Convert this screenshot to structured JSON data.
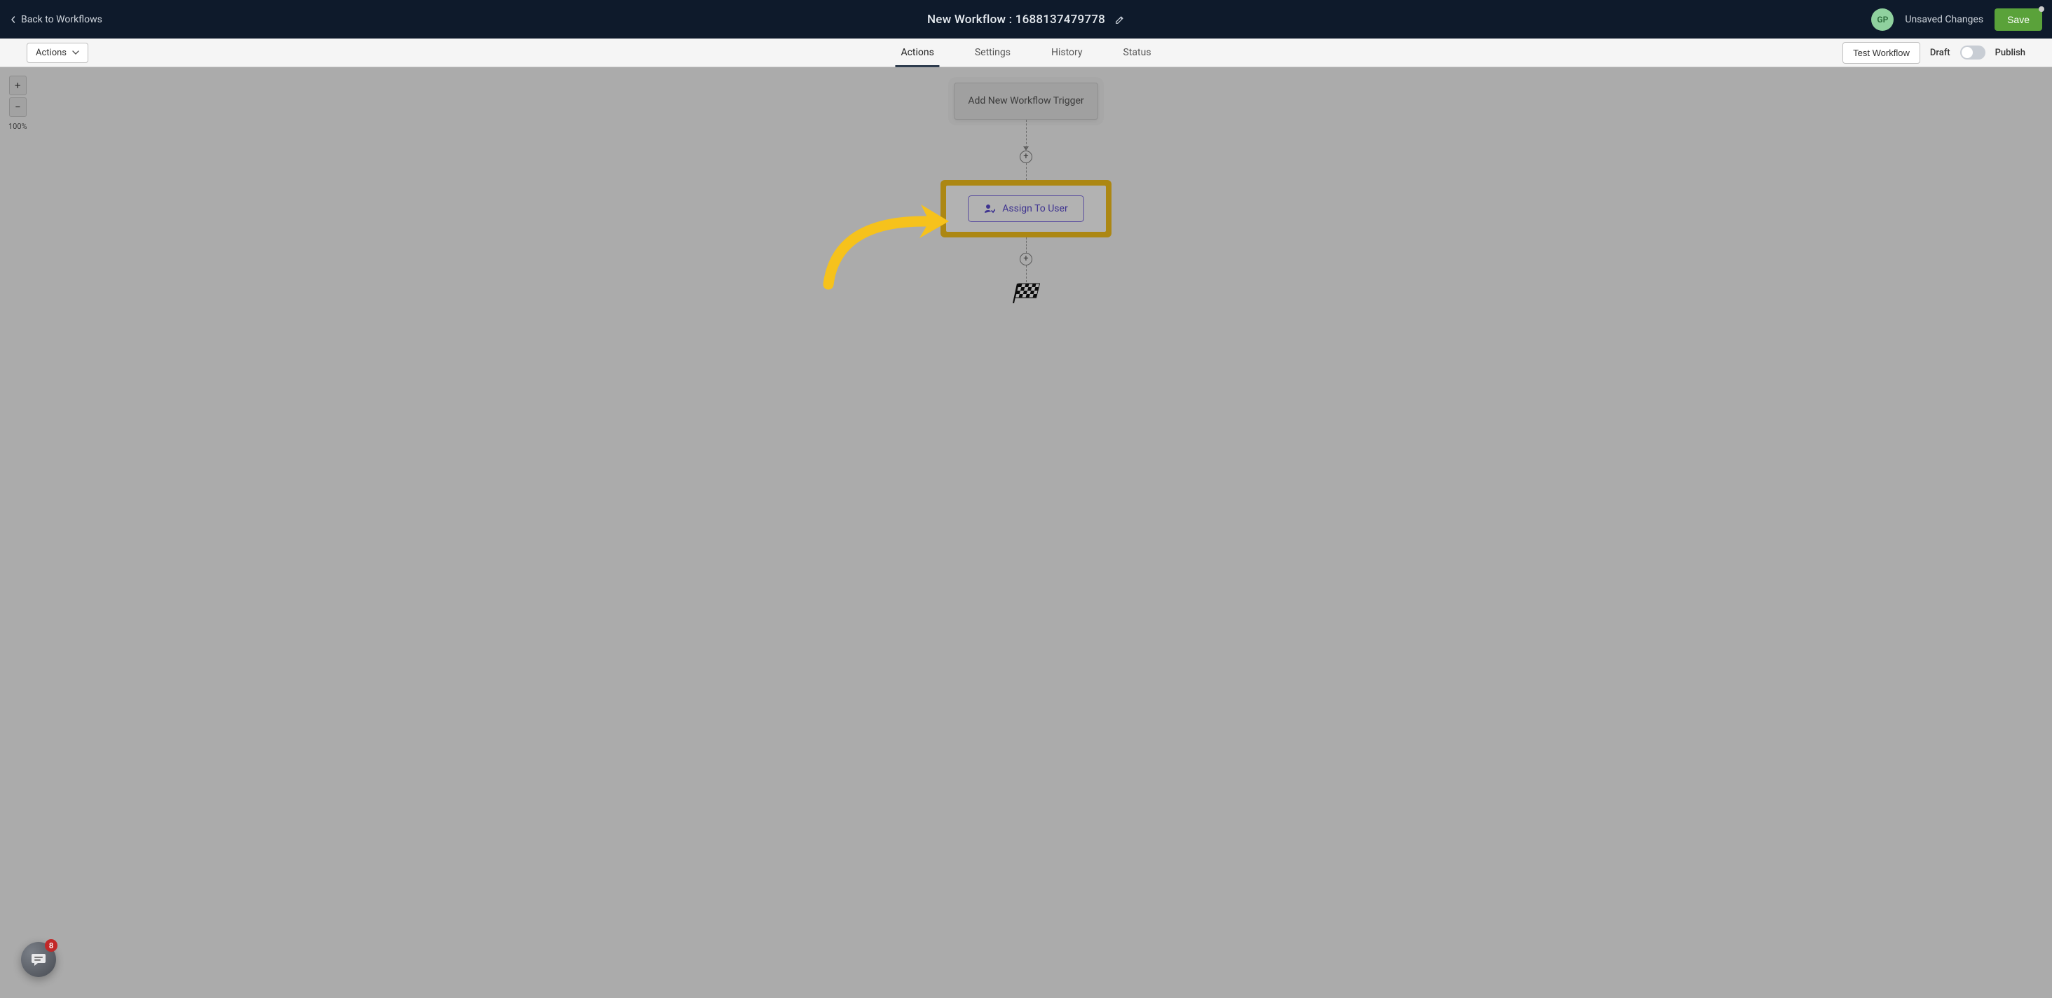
{
  "header": {
    "back_label": "Back to Workflows",
    "title": "New Workflow : 1688137479778",
    "avatar_initials": "GP",
    "unsaved_label": "Unsaved Changes",
    "save_label": "Save"
  },
  "subbar": {
    "actions_label": "Actions",
    "tabs": [
      "Actions",
      "Settings",
      "History",
      "Status"
    ],
    "active_tab_index": 0,
    "test_label": "Test Workflow",
    "draft_label": "Draft",
    "publish_label": "Publish"
  },
  "zoom": {
    "plus": "+",
    "minus": "−",
    "percent": "100%"
  },
  "flow": {
    "trigger_label": "Add New Workflow Trigger",
    "plus_glyph": "+",
    "assign_label": "Assign To User"
  },
  "chat": {
    "badge_count": "8"
  },
  "colors": {
    "highlight_yellow": "#f6c21c",
    "brand_purple": "#5a49cf",
    "save_green": "#5aa23a"
  }
}
